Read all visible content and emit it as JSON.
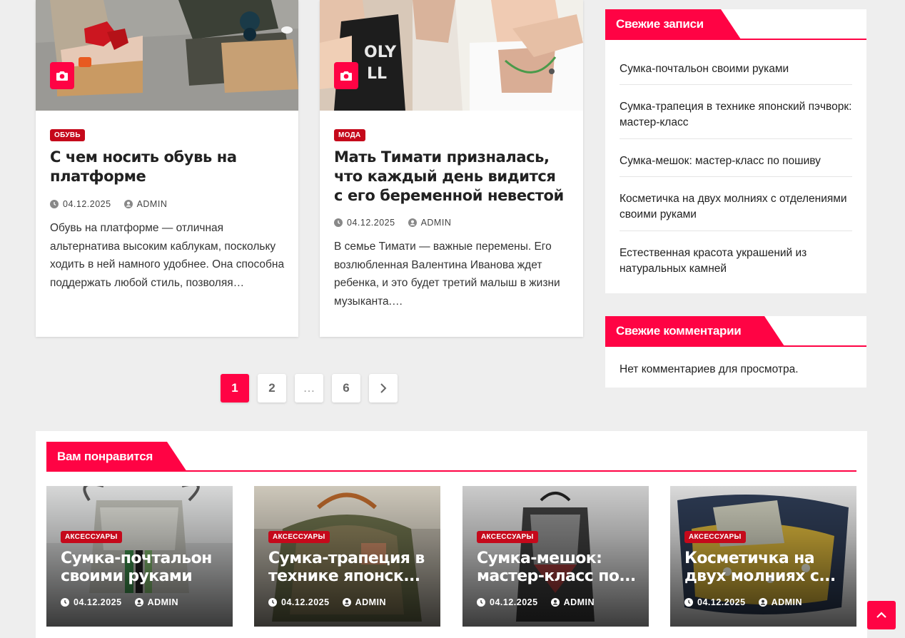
{
  "colors": {
    "accent": "#ff0344",
    "badge": "#c5091b",
    "background": "#eeeeee"
  },
  "posts": [
    {
      "category": "ОБУВЬ",
      "title": "С чем носить обувь на платформе",
      "date": "04.12.2025",
      "author": "ADMIN",
      "excerpt": "Обувь на платформе — отличная альтернатива высоким каблукам, поскольку ходить в ней намного удобнее. Она способна поддержать любой стиль, позволяя…",
      "thumb_icon": "camera-icon"
    },
    {
      "category": "МОДА",
      "title": "Мать Тимати призналась, что каждый день видится с его беременной невестой",
      "date": "04.12.2025",
      "author": "ADMIN",
      "excerpt": "В семье Тимати — важные перемены. Его возлюбленная Валентина Иванова ждет ребенка, и это будет третий малыш в жизни музыканта.…",
      "thumb_icon": "camera-icon"
    }
  ],
  "pagination": {
    "pages": [
      "1",
      "2",
      "…",
      "6"
    ],
    "current": "1",
    "next_icon": "chevron-right-icon"
  },
  "recent_posts": {
    "title": "Свежие записи",
    "items": [
      "Сумка-почтальон своими руками",
      "Сумка-трапеция в технике японский пэчворк: мастер-класс",
      "Сумка-мешок: мастер-класс по пошиву",
      "Косметичка на двух молниях с отделениями своими руками",
      "Естественная красота украшений из натуральных камней"
    ]
  },
  "recent_comments": {
    "title": "Свежие комментарии",
    "empty_text": "Нет комментариев для просмотра."
  },
  "related": {
    "title": "Вам понравится",
    "items": [
      {
        "category": "АКСЕССУАРЫ",
        "title": "Сумка-почтальон своими руками",
        "date": "04.12.2025",
        "author": "ADMIN"
      },
      {
        "category": "АКСЕССУАРЫ",
        "title": "Сумка-трапеция в технике японск...",
        "date": "04.12.2025",
        "author": "ADMIN"
      },
      {
        "category": "АКСЕССУАРЫ",
        "title": "Сумка-мешок: мастер-класс по...",
        "date": "04.12.2025",
        "author": "ADMIN"
      },
      {
        "category": "АКСЕССУАРЫ",
        "title": "Косметичка на двух молниях с...",
        "date": "04.12.2025",
        "author": "ADMIN"
      }
    ]
  },
  "scroll_top_icon": "chevron-up-icon"
}
